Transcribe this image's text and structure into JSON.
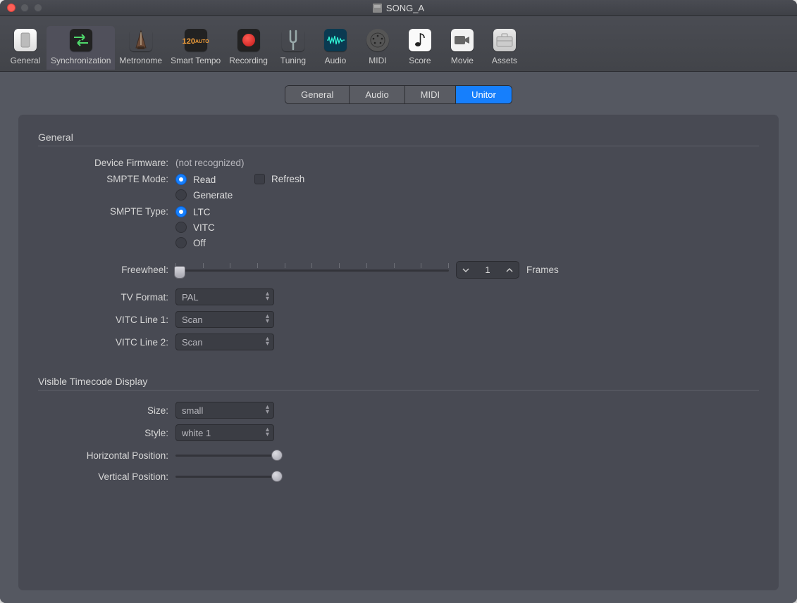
{
  "window": {
    "title": "SONG_A"
  },
  "toolbar": {
    "items": [
      {
        "label": "General"
      },
      {
        "label": "Synchronization"
      },
      {
        "label": "Metronome"
      },
      {
        "label": "Smart Tempo",
        "tempo": "120",
        "tempo_auto": "AUTO"
      },
      {
        "label": "Recording"
      },
      {
        "label": "Tuning"
      },
      {
        "label": "Audio"
      },
      {
        "label": "MIDI"
      },
      {
        "label": "Score"
      },
      {
        "label": "Movie"
      },
      {
        "label": "Assets"
      }
    ]
  },
  "tabs": {
    "general": "General",
    "audio": "Audio",
    "midi": "MIDI",
    "unitor": "Unitor"
  },
  "sections": {
    "general": "General",
    "vtd": "Visible Timecode Display"
  },
  "labels": {
    "device_firmware": "Device Firmware:",
    "smpte_mode": "SMPTE Mode:",
    "smpte_type": "SMPTE Type:",
    "freewheel": "Freewheel:",
    "tv_format": "TV Format:",
    "vitc1": "VITC Line 1:",
    "vitc2": "VITC Line 2:",
    "size": "Size:",
    "style": "Style:",
    "hpos": "Horizontal Position:",
    "vpos": "Vertical Position:",
    "frames": "Frames"
  },
  "values": {
    "device_firmware": "(not recognized)",
    "smpte_mode_options": {
      "read": "Read",
      "generate": "Generate",
      "refresh": "Refresh"
    },
    "smpte_type_options": {
      "ltc": "LTC",
      "vitc": "VITC",
      "off": "Off"
    },
    "freewheel": "1",
    "tv_format": "PAL",
    "vitc1": "Scan",
    "vitc2": "Scan",
    "size": "small",
    "style": "white 1"
  }
}
